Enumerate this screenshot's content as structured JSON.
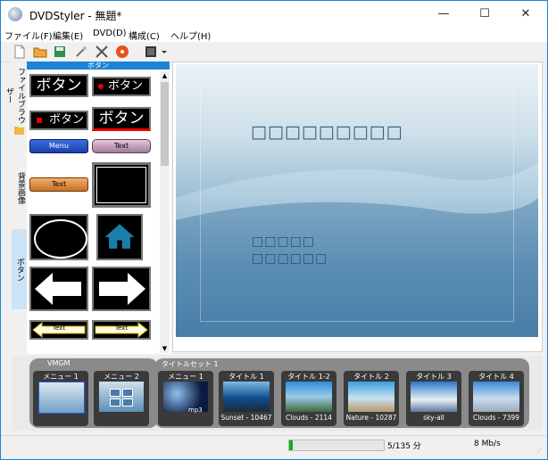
{
  "window": {
    "title": "DVDStyler - 無題*",
    "minimize_glyph": "—",
    "maximize_glyph": "☐",
    "close_glyph": "✕"
  },
  "menu": [
    "ファイル(F)",
    "編集(E)",
    "DVD(D)",
    "構成(C)",
    "ヘルプ(H)"
  ],
  "toolbar": {
    "icons": [
      "new-document-icon",
      "open-folder-icon",
      "save-icon",
      "wand-icon",
      "settings-tools-icon",
      "burn-disc-icon",
      "add-video-icon",
      "dropdown-arrow-icon"
    ]
  },
  "side_tabs": [
    "ファイルブラウザー",
    "背景画像",
    "ボタン"
  ],
  "panel": {
    "header": "ボタン",
    "buttons": [
      {
        "text": "ボタン"
      },
      {
        "text": "ボタン"
      },
      {
        "text": "ボタン"
      },
      {
        "text": "ボタン"
      },
      {
        "text": "Menu"
      },
      {
        "text": "Text"
      },
      {
        "text": "Text"
      },
      {
        "text": ""
      },
      {
        "text": ""
      },
      {
        "text": ""
      },
      {
        "text": ""
      },
      {
        "text": ""
      },
      {
        "text": "Text"
      },
      {
        "text": "Text"
      }
    ]
  },
  "canvas": {
    "title_text": "□□□□□□□□□",
    "line1": "□□□□□",
    "line2": "□□□□□□"
  },
  "bottom": {
    "vmgm_label": "VMGM",
    "titleset_label": "タイトルセット 1",
    "vmgm_menus": [
      {
        "label": "メニュー 1"
      },
      {
        "label": "メニュー 2"
      }
    ],
    "titleset_menu": {
      "label": "メニュー 1",
      "caption": "mp3"
    },
    "titles": [
      {
        "label": "タイトル 1",
        "caption": "Sunset - 10467"
      },
      {
        "label": "タイトル 1-2",
        "caption": "Clouds - 2114"
      },
      {
        "label": "タイトル 2",
        "caption": "Nature - 10287"
      },
      {
        "label": "タイトル 3",
        "caption": "sky-all"
      },
      {
        "label": "タイトル 4",
        "caption": "Clouds - 7399"
      }
    ]
  },
  "status": {
    "progress_fraction": 0.04,
    "duration": "5/135 分",
    "bitrate": "8 Mb/s"
  },
  "colors": {
    "accent": "#1a85d6",
    "progress": "#06b025"
  }
}
